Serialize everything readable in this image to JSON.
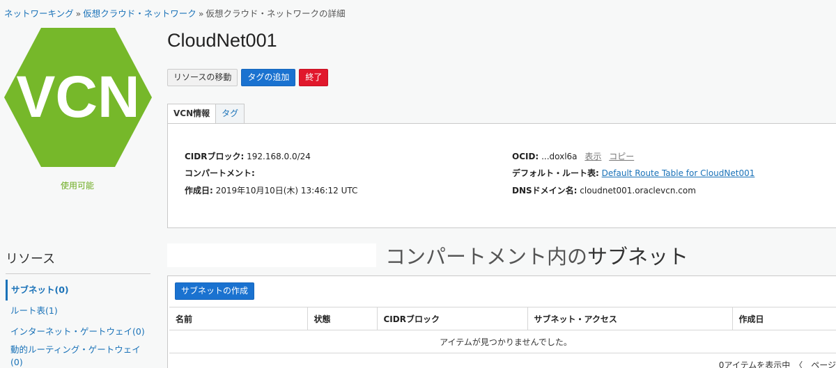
{
  "breadcrumb": {
    "items": [
      "ネットワーキング",
      "仮想クラウド・ネットワーク",
      "仮想クラウド・ネットワークの詳細"
    ],
    "separator": "»"
  },
  "logo": {
    "text": "VCN",
    "color": "#76b82a",
    "status": "使用可能",
    "icon": "vcn-hexagon-icon"
  },
  "page": {
    "title": "CloudNet001"
  },
  "actions": {
    "move": "リソースの移動",
    "add_tags": "タグの追加",
    "terminate": "終了"
  },
  "tabs": [
    "VCN情報",
    "タグ"
  ],
  "info": {
    "cidr_label": "CIDRブロック:",
    "cidr_value": "192.168.0.0/24",
    "compartment_label": "コンパートメント:",
    "compartment_value": "",
    "created_label": "作成日:",
    "created_value": "2019年10月10日(木) 13:46:12 UTC",
    "ocid_label": "OCID:",
    "ocid_value": "...doxl6a",
    "ocid_show": "表示",
    "ocid_copy": "コピー",
    "route_label": "デフォルト・ルート表:",
    "route_value": "Default Route Table for CloudNet001",
    "dns_label": "DNSドメイン名:",
    "dns_value": "cloudnet001.oraclevcn.com"
  },
  "resources": {
    "title": "リソース",
    "items": [
      "サブネット(0)",
      "ルート表(1)",
      "インターネット・ゲートウェイ(0)",
      "動的ルーティング・ゲートウェイ",
      "(0)"
    ]
  },
  "subnets": {
    "title_prefix": "コンパートメント内の",
    "title_emph": "サブネット",
    "create_button": "サブネットの作成",
    "columns": [
      "名前",
      "状態",
      "CIDRブロック",
      "サブネット・アクセス",
      "作成日"
    ],
    "empty_message": "アイテムが見つかりませんでした。",
    "footer": "0アイテムを表示中　〈　ページ"
  },
  "colors": {
    "primary": "#1a72d0",
    "danger": "#e1182c",
    "link": "#1a72b8",
    "vcn_green": "#76b82a"
  }
}
